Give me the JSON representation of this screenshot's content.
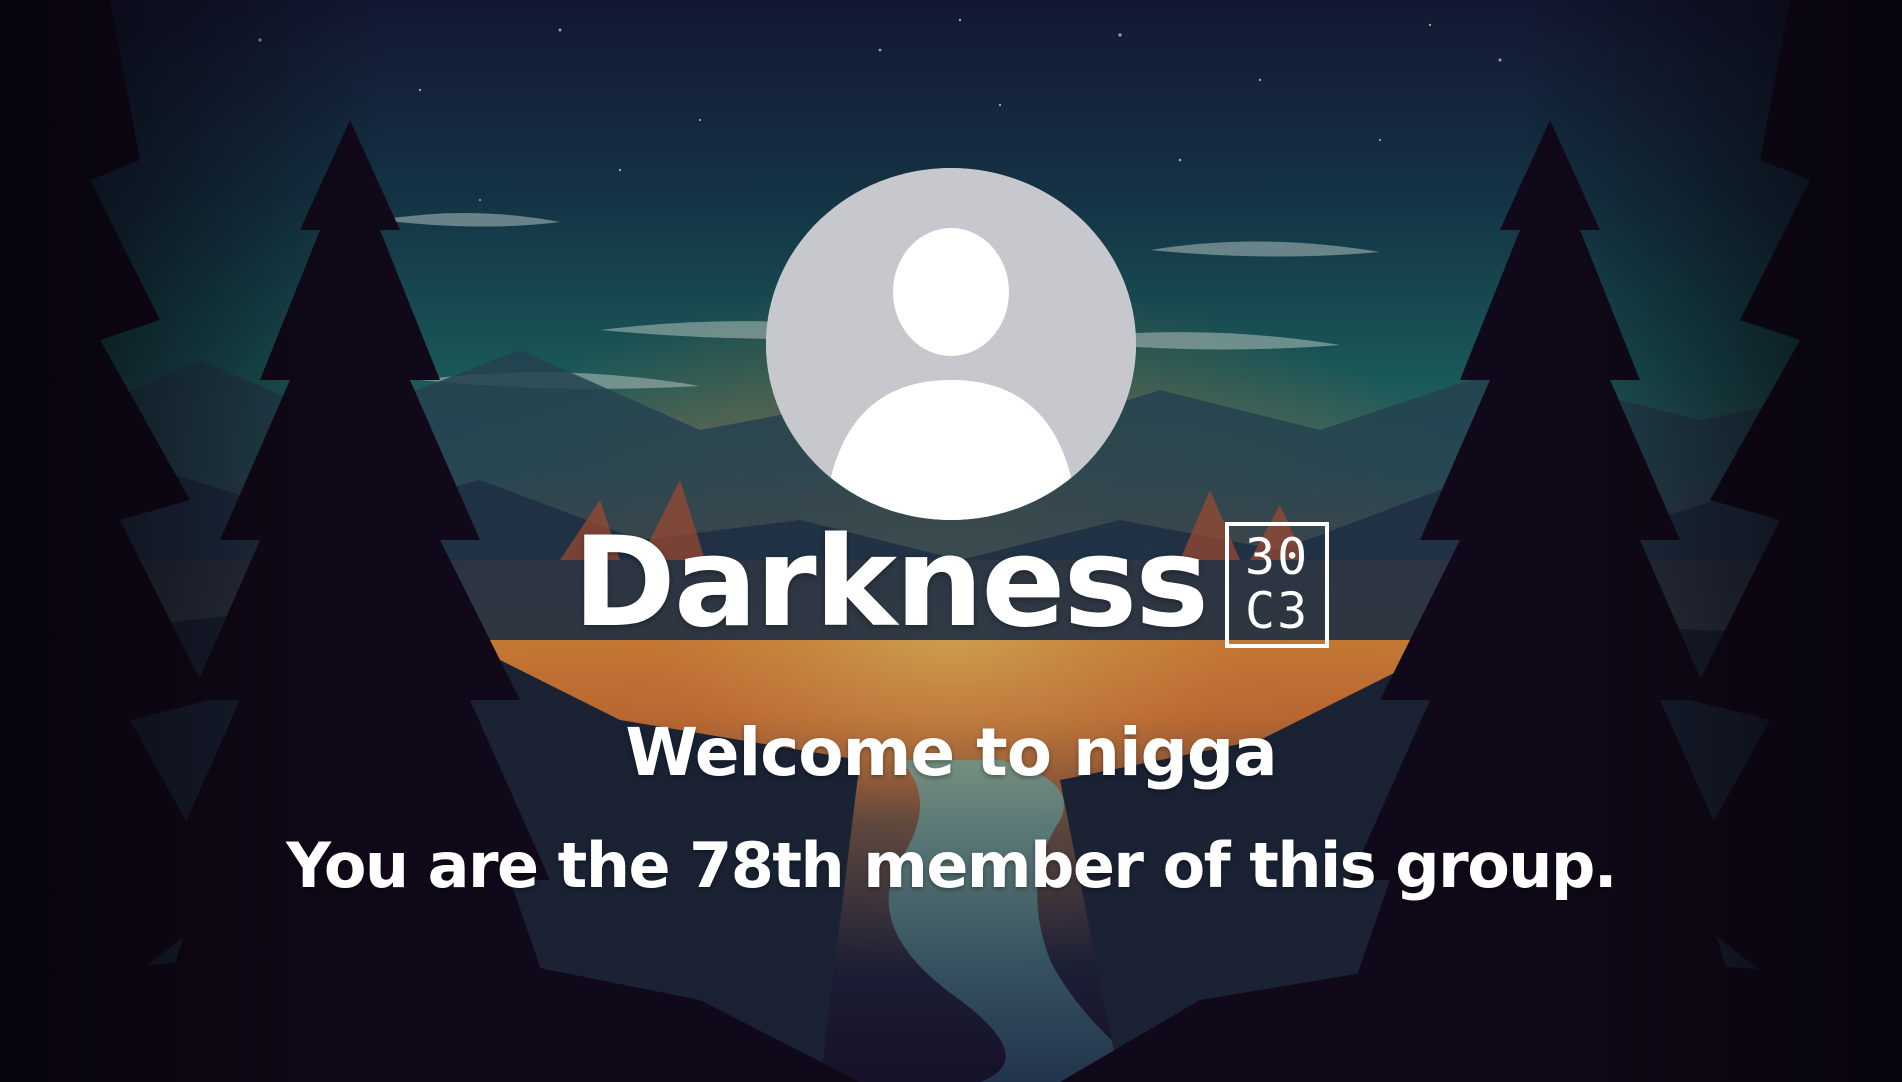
{
  "card": {
    "username": "Darkness",
    "name_glyph": {
      "top": "30",
      "bottom": "C3"
    },
    "welcome_text": "Welcome to nigga",
    "member_text": "You are the 78th member of this group."
  },
  "avatar": {
    "icon": "default-user-avatar-icon",
    "background_color": "#c6c8cd",
    "figure_color": "#ffffff"
  },
  "background": {
    "scene": "forest-sunset-landscape",
    "sky_color": "#1d6b6a",
    "glow_color": "#f5a040",
    "tree_color": "#130a1c"
  },
  "text_color": "#ffffff"
}
